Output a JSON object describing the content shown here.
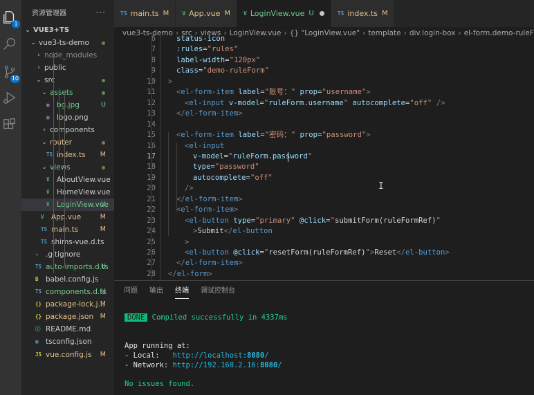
{
  "explorer": {
    "title": "资源管理器",
    "more": "···",
    "project": "VUE3+TS",
    "items": [
      {
        "label": "vue3-ts-demo",
        "icon": "",
        "chev": "⌄",
        "status": "dot",
        "color": "#cccccc",
        "depth": 1
      },
      {
        "label": "node_modules",
        "icon": "",
        "chev": "›",
        "status": "",
        "color": "#8c8c8c",
        "depth": 2
      },
      {
        "label": "public",
        "icon": "",
        "chev": "›",
        "status": "",
        "color": "#cccccc",
        "depth": 2
      },
      {
        "label": "src",
        "icon": "",
        "chev": "⌄",
        "status": "dot",
        "color": "#cccccc",
        "depth": 2
      },
      {
        "label": "assets",
        "icon": "",
        "chev": "⌄",
        "status": "dot",
        "color": "#73c991",
        "depth": 3
      },
      {
        "label": "bg.jpg",
        "icon": "▣",
        "status": "U",
        "color": "#73c991",
        "iconColor": "#a074c4",
        "depth": 4
      },
      {
        "label": "logo.png",
        "icon": "▣",
        "status": "",
        "color": "#cccccc",
        "iconColor": "#a074c4",
        "depth": 4
      },
      {
        "label": "components",
        "icon": "",
        "chev": "›",
        "status": "",
        "color": "#cccccc",
        "depth": 3
      },
      {
        "label": "router",
        "icon": "",
        "chev": "⌄",
        "status": "dot",
        "color": "#e2c08d",
        "depth": 3
      },
      {
        "label": "index.ts",
        "icon": "TS",
        "status": "M",
        "color": "#e2c08d",
        "iconColor": "#519aba",
        "depth": 4
      },
      {
        "label": "views",
        "icon": "",
        "chev": "⌄",
        "status": "dot",
        "color": "#73c991",
        "depth": 3
      },
      {
        "label": "AboutView.vue",
        "icon": "V",
        "status": "",
        "color": "#cccccc",
        "iconColor": "#41b883",
        "depth": 4
      },
      {
        "label": "HomeView.vue",
        "icon": "V",
        "status": "",
        "color": "#cccccc",
        "iconColor": "#41b883",
        "depth": 4
      },
      {
        "label": "LoginView.vue",
        "icon": "V",
        "status": "U",
        "color": "#73c991",
        "iconColor": "#41b883",
        "depth": 4,
        "selected": true
      },
      {
        "label": "App.vue",
        "icon": "V",
        "status": "M",
        "color": "#e2c08d",
        "iconColor": "#41b883",
        "depth": 3
      },
      {
        "label": "main.ts",
        "icon": "TS",
        "status": "M",
        "color": "#e2c08d",
        "iconColor": "#519aba",
        "depth": 3
      },
      {
        "label": "shims-vue.d.ts",
        "icon": "TS",
        "status": "",
        "color": "#cccccc",
        "iconColor": "#519aba",
        "depth": 3
      },
      {
        "label": ".gitignore",
        "icon": "◆",
        "status": "",
        "color": "#cccccc",
        "iconColor": "#41535b",
        "depth": 2
      },
      {
        "label": "auto-imports.d.ts",
        "icon": "TS",
        "status": "U",
        "color": "#73c991",
        "iconColor": "#519aba",
        "depth": 2
      },
      {
        "label": "babel.config.js",
        "icon": "B",
        "status": "",
        "color": "#cccccc",
        "iconColor": "#cbcb41",
        "depth": 2
      },
      {
        "label": "components.d.ts",
        "icon": "TS",
        "status": "U",
        "color": "#73c991",
        "iconColor": "#519aba",
        "depth": 2
      },
      {
        "label": "package-lock.j...",
        "icon": "{}",
        "status": "M",
        "color": "#e2c08d",
        "iconColor": "#cbcb41",
        "depth": 2
      },
      {
        "label": "package.json",
        "icon": "{}",
        "status": "M",
        "color": "#e2c08d",
        "iconColor": "#cbcb41",
        "depth": 2
      },
      {
        "label": "README.md",
        "icon": "ⓘ",
        "status": "",
        "color": "#cccccc",
        "iconColor": "#519aba",
        "depth": 2
      },
      {
        "label": "tsconfig.json",
        "icon": "▣",
        "status": "",
        "color": "#cccccc",
        "iconColor": "#519aba",
        "depth": 2
      },
      {
        "label": "vue.config.js",
        "icon": "JS",
        "status": "M",
        "color": "#e2c08d",
        "iconColor": "#cbcb41",
        "depth": 2
      }
    ]
  },
  "activity": {
    "scm_badge": "10",
    "explorer_badge": "1"
  },
  "tabs": [
    {
      "label": "main.ts",
      "icon": "TS",
      "iconColor": "#519aba",
      "status": "M",
      "labelColor": "#e2c08d"
    },
    {
      "label": "App.vue",
      "icon": "V",
      "iconColor": "#41b883",
      "status": "M",
      "labelColor": "#e2c08d"
    },
    {
      "label": "LoginView.vue",
      "icon": "V",
      "iconColor": "#41b883",
      "status": "U",
      "labelColor": "#73c991",
      "active": true,
      "dirty": true
    },
    {
      "label": "index.ts",
      "icon": "TS",
      "iconColor": "#519aba",
      "status": "M",
      "labelColor": "#e2c08d"
    }
  ],
  "breadcrumbs": [
    "vue3-ts-demo",
    "src",
    "views",
    "LoginView.vue",
    "{} \"LoginView.vue\"",
    "template",
    "div.login-box",
    "el-form.demo-ruleFo"
  ],
  "code": {
    "current_line": 17,
    "lines": [
      {
        "n": 6,
        "i": 1,
        "t": [
          [
            "attr",
            "status-icon"
          ]
        ]
      },
      {
        "n": 7,
        "i": 1,
        "t": [
          [
            "attr",
            ":rules"
          ],
          [
            "txt",
            "="
          ],
          [
            "str",
            "\"rules\""
          ]
        ]
      },
      {
        "n": 8,
        "i": 1,
        "t": [
          [
            "attr",
            "label-width"
          ],
          [
            "txt",
            "="
          ],
          [
            "str",
            "\"120px\""
          ]
        ]
      },
      {
        "n": 9,
        "i": 1,
        "t": [
          [
            "attr",
            "class"
          ],
          [
            "txt",
            "="
          ],
          [
            "str",
            "\"demo-ruleForm\""
          ]
        ]
      },
      {
        "n": 10,
        "i": 0,
        "t": [
          [
            "brk",
            ">"
          ]
        ]
      },
      {
        "n": 11,
        "i": 1,
        "t": [
          [
            "brk",
            "<"
          ],
          [
            "tag",
            "el-form-item"
          ],
          [
            "txt",
            " "
          ],
          [
            "attr",
            "label"
          ],
          [
            "txt",
            "="
          ],
          [
            "str",
            "\"账号：\""
          ],
          [
            "txt",
            " "
          ],
          [
            "attr",
            "prop"
          ],
          [
            "txt",
            "="
          ],
          [
            "str",
            "\"username\""
          ],
          [
            "brk",
            ">"
          ]
        ]
      },
      {
        "n": 12,
        "i": 2,
        "t": [
          [
            "brk",
            "<"
          ],
          [
            "tag",
            "el-input"
          ],
          [
            "txt",
            " "
          ],
          [
            "attr",
            "v-model"
          ],
          [
            "txt",
            "="
          ],
          [
            "str",
            "\""
          ],
          [
            "attr",
            "ruleForm.username"
          ],
          [
            "str",
            "\""
          ],
          [
            "txt",
            " "
          ],
          [
            "attr",
            "autocomplete"
          ],
          [
            "txt",
            "="
          ],
          [
            "str",
            "\"off\""
          ],
          [
            "txt",
            " "
          ],
          [
            "brk",
            "/>"
          ]
        ]
      },
      {
        "n": 13,
        "i": 1,
        "t": [
          [
            "brk",
            "</"
          ],
          [
            "tag",
            "el-form-item"
          ],
          [
            "brk",
            ">"
          ]
        ]
      },
      {
        "n": 14,
        "i": 0,
        "t": []
      },
      {
        "n": 15,
        "i": 1,
        "t": [
          [
            "brk",
            "<"
          ],
          [
            "tag",
            "el-form-item"
          ],
          [
            "txt",
            " "
          ],
          [
            "attr",
            "label"
          ],
          [
            "txt",
            "="
          ],
          [
            "str",
            "\"密码：\""
          ],
          [
            "txt",
            " "
          ],
          [
            "attr",
            "prop"
          ],
          [
            "txt",
            "="
          ],
          [
            "str",
            "\"password\""
          ],
          [
            "brk",
            ">"
          ]
        ]
      },
      {
        "n": 16,
        "i": 2,
        "t": [
          [
            "brk",
            "<"
          ],
          [
            "tag",
            "el-input"
          ]
        ]
      },
      {
        "n": 17,
        "i": 3,
        "t": [
          [
            "attr",
            "v-model"
          ],
          [
            "txt",
            "="
          ],
          [
            "str",
            "\""
          ],
          [
            "attr",
            "ruleForm.password"
          ],
          [
            "str",
            "\""
          ]
        ]
      },
      {
        "n": 18,
        "i": 3,
        "t": [
          [
            "attr",
            "type"
          ],
          [
            "txt",
            "="
          ],
          [
            "str",
            "\"password\""
          ]
        ]
      },
      {
        "n": 19,
        "i": 3,
        "t": [
          [
            "attr",
            "autocomplete"
          ],
          [
            "txt",
            "="
          ],
          [
            "str",
            "\"off\""
          ]
        ]
      },
      {
        "n": 20,
        "i": 2,
        "t": [
          [
            "brk",
            "/>"
          ]
        ]
      },
      {
        "n": 21,
        "i": 1,
        "t": [
          [
            "brk",
            "</"
          ],
          [
            "tag",
            "el-form-item"
          ],
          [
            "brk",
            ">"
          ]
        ]
      },
      {
        "n": 22,
        "i": 1,
        "t": [
          [
            "brk",
            "<"
          ],
          [
            "tag",
            "el-form-item"
          ],
          [
            "brk",
            ">"
          ]
        ]
      },
      {
        "n": 23,
        "i": 2,
        "t": [
          [
            "brk",
            "<"
          ],
          [
            "tag",
            "el-button"
          ],
          [
            "txt",
            " "
          ],
          [
            "attr",
            "type"
          ],
          [
            "txt",
            "="
          ],
          [
            "str",
            "\"primary\""
          ],
          [
            "txt",
            " "
          ],
          [
            "attr",
            "@click"
          ],
          [
            "txt",
            "="
          ],
          [
            "str",
            "\""
          ],
          [
            "txt",
            "submitForm(ruleFormRef)"
          ],
          [
            "str",
            "\""
          ]
        ]
      },
      {
        "n": 24,
        "i": 3,
        "t": [
          [
            "brk",
            ">"
          ],
          [
            "txt",
            "Submit"
          ],
          [
            "brk",
            "</"
          ],
          [
            "tag",
            "el-button"
          ]
        ]
      },
      {
        "n": 25,
        "i": 2,
        "t": [
          [
            "brk",
            ">"
          ]
        ]
      },
      {
        "n": 26,
        "i": 2,
        "t": [
          [
            "brk",
            "<"
          ],
          [
            "tag",
            "el-button"
          ],
          [
            "txt",
            " "
          ],
          [
            "attr",
            "@click"
          ],
          [
            "txt",
            "="
          ],
          [
            "str",
            "\""
          ],
          [
            "txt",
            "resetForm(ruleFormRef)"
          ],
          [
            "str",
            "\""
          ],
          [
            "brk",
            ">"
          ],
          [
            "txt",
            "Reset"
          ],
          [
            "brk",
            "</"
          ],
          [
            "tag",
            "el-button"
          ],
          [
            "brk",
            ">"
          ]
        ]
      },
      {
        "n": 27,
        "i": 1,
        "t": [
          [
            "brk",
            "</"
          ],
          [
            "tag",
            "el-form-item"
          ],
          [
            "brk",
            ">"
          ]
        ]
      },
      {
        "n": 28,
        "i": 0,
        "t": [
          [
            "brk",
            "</"
          ],
          [
            "tag",
            "el-form"
          ],
          [
            "brk",
            ">"
          ]
        ]
      }
    ]
  },
  "panel": {
    "tabs": [
      "问题",
      "输出",
      "终端",
      "调试控制台"
    ],
    "active_tab": "终端",
    "terminal": {
      "done_badge": "DONE",
      "compiled": "Compiled successfully in 4337ms",
      "running": "App running at:",
      "local_label": "- Local:   ",
      "local_url_a": "http://localhost:",
      "local_port": "8080",
      "local_url_b": "/",
      "network_label": "- Network: ",
      "network_url_a": "http://192.168.2.16:",
      "network_port": "8080",
      "network_url_b": "/",
      "no_issues": "No issues found."
    }
  }
}
